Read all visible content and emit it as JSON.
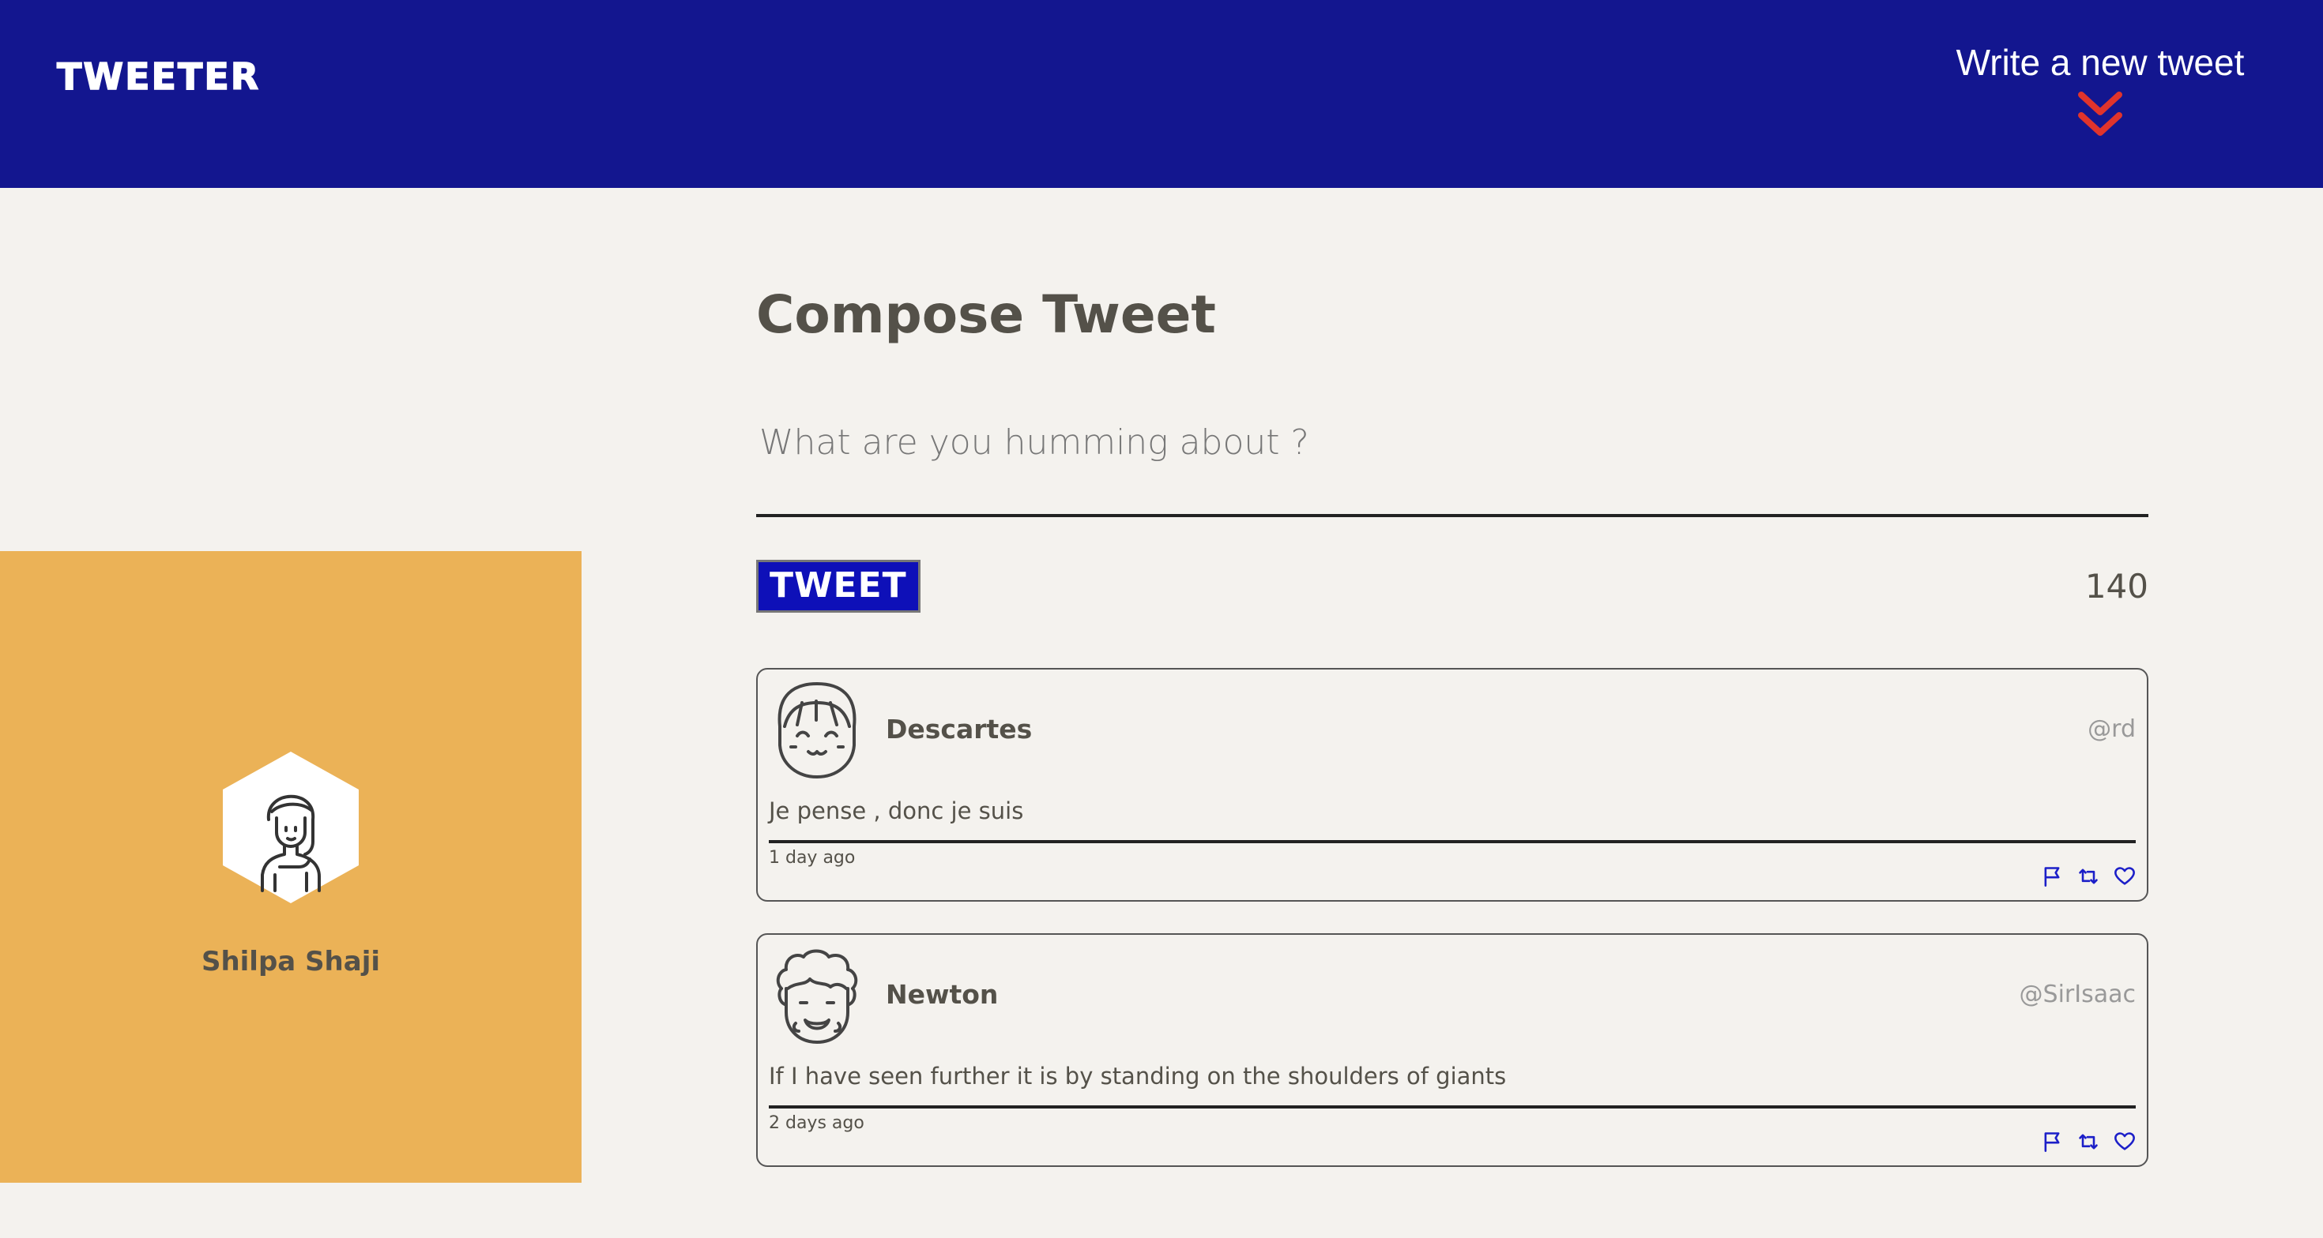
{
  "nav": {
    "brand": "TWEETER",
    "write_new_label": "Write a new tweet",
    "chevron_icon": "double-chevron-down-icon",
    "chevron_color": "#e0342c",
    "background_color": "#13168f"
  },
  "profile": {
    "name": "Shilpa Shaji",
    "avatar_icon": "woman-avatar-icon",
    "background_color": "#ebb257"
  },
  "composer": {
    "title": "Compose Tweet",
    "placeholder": "What are you humming about ?",
    "value": "",
    "tweet_button_label": "TWEET",
    "counter": "140"
  },
  "tweets": [
    {
      "name": "Descartes",
      "handle": "@rd",
      "content": "Je pense , donc je suis",
      "date": "1 day ago",
      "avatar_icon": "girl-avatar-icon"
    },
    {
      "name": "Newton",
      "handle": "@SirIsaac",
      "content": "If I have seen further it is by standing on the shoulders of giants",
      "date": "2 days ago",
      "avatar_icon": "curly-hair-man-avatar-icon"
    }
  ],
  "actions": {
    "flag_icon": "flag-icon",
    "retweet_icon": "retweet-icon",
    "like_icon": "heart-icon",
    "color": "#1c1fc8"
  }
}
